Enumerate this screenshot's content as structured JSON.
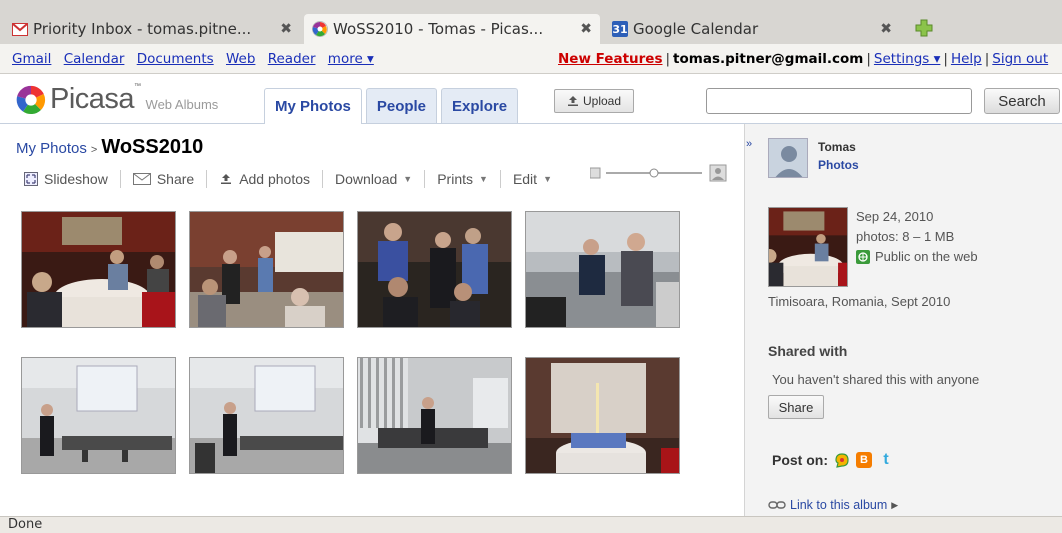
{
  "browser": {
    "tabs": [
      {
        "title": "Priority Inbox - tomas.pitne...",
        "favicon": "gmail-icon",
        "active": false
      },
      {
        "title": "WoSS2010 - Tomas - Picas...",
        "favicon": "picasa-icon",
        "active": true
      },
      {
        "title": "Google Calendar",
        "favicon": "calendar-icon",
        "active": false
      }
    ],
    "calendar_favicon_text": "31",
    "status": "Done"
  },
  "gbar": {
    "links": [
      "Gmail",
      "Calendar",
      "Documents",
      "Web",
      "Reader",
      "more ▾"
    ],
    "new_features": "New Features",
    "email": "tomas.pitner@gmail.com",
    "settings": "Settings ▾",
    "help": "Help",
    "sign_out": "Sign out"
  },
  "picasa": {
    "logo_word": "Picasa",
    "logo_tm": "™",
    "logo_sub": "Web Albums",
    "tabs": [
      "My Photos",
      "People",
      "Explore"
    ],
    "upload_label": "Upload",
    "search_value": "",
    "search_button": "Search"
  },
  "album": {
    "breadcrumb_link": "My Photos",
    "breadcrumb_sep": ">",
    "title": "WoSS2010",
    "toolbar": {
      "slideshow": "Slideshow",
      "share": "Share",
      "add_photos": "Add photos",
      "download": "Download",
      "prints": "Prints",
      "edit": "Edit"
    },
    "photo_count": 8
  },
  "panel": {
    "collapse_glyph": "»",
    "owner": "Tomas",
    "photos_link": "Photos",
    "date": "Sep 24, 2010",
    "photos_info": "photos: 8 – 1 MB",
    "visibility": "Public on the web",
    "description": "Timisoara, Romania, Sept 2010",
    "shared_heading": "Shared with",
    "shared_text": "You haven't shared this with anyone",
    "share_button": "Share",
    "post_on": "Post on:",
    "link_album": "Link to this album"
  },
  "colors": {
    "link": "#2a49a3",
    "gbar_link": "#1a2fb8",
    "new_features": "#cc0000",
    "tab_bg": "#e4ebf5"
  }
}
